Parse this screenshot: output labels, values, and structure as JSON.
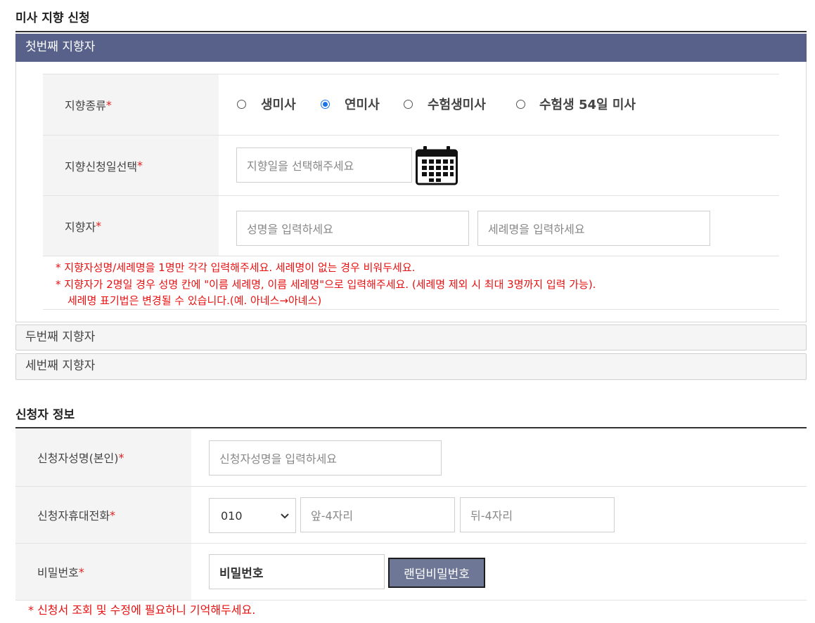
{
  "mass_section": {
    "title": "미사 지향 신청",
    "first_intender": {
      "header": "첫번째 지향자",
      "type_row": {
        "label": "지향종류",
        "required_mark": "*",
        "options": [
          {
            "label": "생미사",
            "checked": false
          },
          {
            "label": "연미사",
            "checked": true
          },
          {
            "label": "수험생미사",
            "checked": false
          },
          {
            "label": "수험생 54일 미사",
            "checked": false
          }
        ]
      },
      "date_row": {
        "label": "지향신청일선택",
        "required_mark": "*",
        "date_placeholder": "지향일을 선택해주세요",
        "calendar_icon": "calendar-icon"
      },
      "name_row": {
        "label": "지향자",
        "required_mark": "*",
        "name_placeholder": "성명을 입력하세요",
        "baptismal_placeholder": "세례명을 입력하세요"
      },
      "notes": [
        "* 지향자성명/세례명을 1명만 각각 입력해주세요.  세례명이 없는 경우 비워두세요.",
        "* 지향자가 2명일 경우 성명 칸에 \"이름 세례명, 이름 세례명\"으로 입력해주세요. (세례명 제외 시 최대 3명까지 입력 가능).",
        "세례명 표기법은 변경될 수 있습니다.(예. 아네스→아녜스)"
      ]
    },
    "second_intender": {
      "header": "두번째 지향자"
    },
    "third_intender": {
      "header": "세번째 지향자"
    }
  },
  "applicant_section": {
    "title": "신청자 정보",
    "name_row": {
      "label": "신청자성명(본인)",
      "required_mark": "*",
      "placeholder": "신청자성명을 입력하세요"
    },
    "phone_row": {
      "label": "신청자휴대전화",
      "required_mark": "*",
      "prefix_value": "010",
      "middle_placeholder": "앞-4자리",
      "last_placeholder": "뒤-4자리"
    },
    "password_row": {
      "label": "비밀번호",
      "required_mark": "*",
      "password_value": "비밀번호",
      "random_button": "랜덤비밀번호"
    },
    "note": "* 신청서 조회 및 수정에 필요하니 기억해두세요."
  },
  "colors": {
    "accent_header": "#57618a",
    "button_bg": "#6e7796",
    "required": "#e02020",
    "note_text": "#e81010",
    "radio_checked": "#1a73e8"
  }
}
